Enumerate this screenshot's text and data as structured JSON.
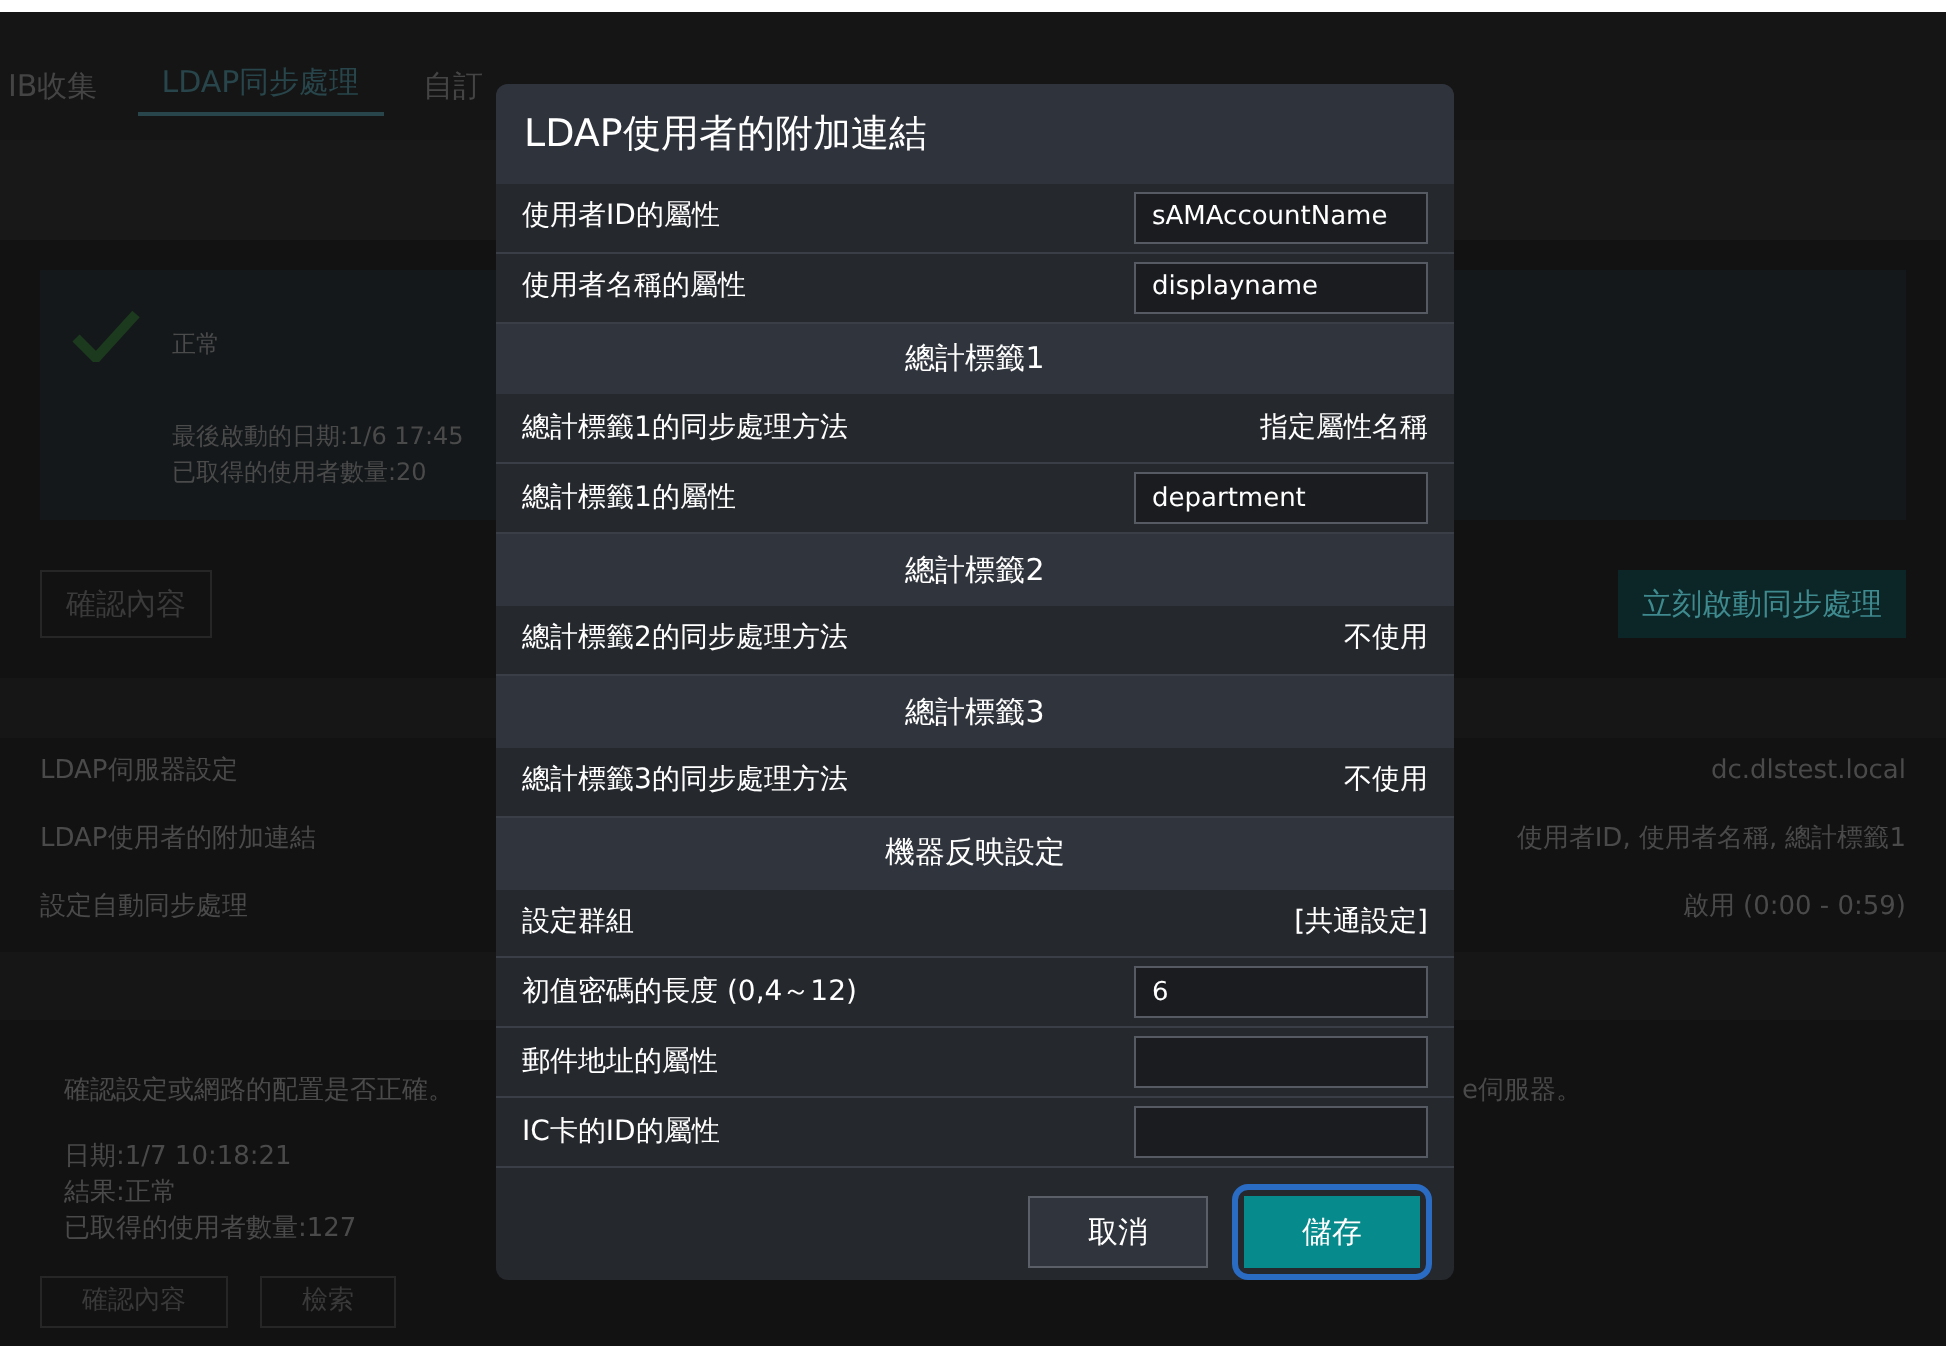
{
  "background": {
    "tabs": [
      {
        "label": "IB收集",
        "selected": false
      },
      {
        "label": "LDAP同步處理",
        "selected": true
      },
      {
        "label": "自訂",
        "selected": false
      }
    ],
    "status": {
      "title": "正常",
      "last_run": "最後啟動的日期:1/6 17:45",
      "user_count": "已取得的使用者數量:20"
    },
    "confirm_button": "確認內容",
    "sync_button": "立刻啟動同步處理",
    "settings": [
      {
        "label": "LDAP伺服器設定",
        "value": "dc.dlstest.local"
      },
      {
        "label": "LDAP使用者的附加連結",
        "value": "使用者ID, 使用者名稱, 總計標籤1"
      },
      {
        "label": "設定自動同步處理",
        "value": "啟用 (0:00 - 0:59)"
      }
    ],
    "message": {
      "text": "確認設定或網路的配置是否正確。",
      "text_tail": "e伺服器。",
      "date": "日期:1/7 10:18:21",
      "result": "結果:正常",
      "user_count": "已取得的使用者數量:127"
    },
    "bottom_buttons": [
      "確認內容",
      "檢索"
    ]
  },
  "dialog": {
    "title": "LDAP使用者的附加連結",
    "rows": [
      {
        "kind": "input",
        "label": "使用者ID的屬性",
        "value": "sAMAccountName"
      },
      {
        "kind": "input",
        "label": "使用者名稱的屬性",
        "value": "displayname"
      },
      {
        "kind": "section",
        "label": "總計標籤1"
      },
      {
        "kind": "value",
        "label": "總計標籤1的同步處理方法",
        "value": "指定屬性名稱"
      },
      {
        "kind": "input",
        "label": "總計標籤1的屬性",
        "value": "department"
      },
      {
        "kind": "section",
        "label": "總計標籤2"
      },
      {
        "kind": "value",
        "label": "總計標籤2的同步處理方法",
        "value": "不使用"
      },
      {
        "kind": "section",
        "label": "總計標籤3"
      },
      {
        "kind": "value",
        "label": "總計標籤3的同步處理方法",
        "value": "不使用"
      },
      {
        "kind": "section",
        "label": "機器反映設定"
      },
      {
        "kind": "value",
        "label": "設定群組",
        "value": "[共通設定]"
      },
      {
        "kind": "input",
        "label": "初值密碼的長度 (0,4～12)",
        "value": "6"
      },
      {
        "kind": "input",
        "label": "郵件地址的屬性"
      },
      {
        "kind": "input",
        "label": "IC卡的ID的屬性"
      }
    ],
    "buttons": [
      {
        "label": "取消",
        "kind": "secondary",
        "focused": false
      },
      {
        "label": "儲存",
        "kind": "primary",
        "focused": true
      }
    ]
  }
}
